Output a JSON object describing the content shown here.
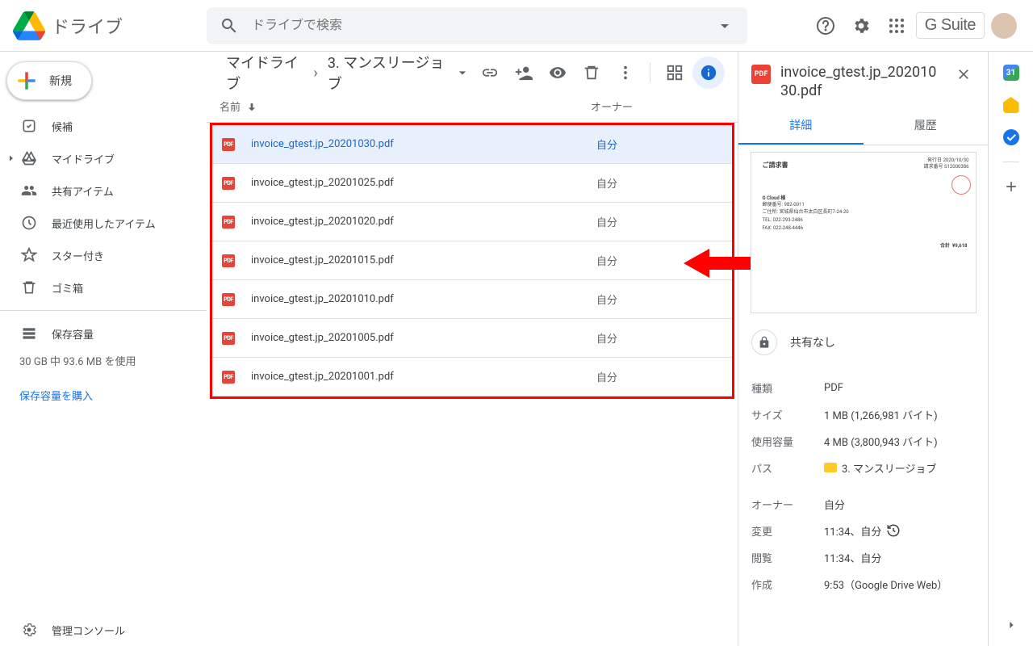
{
  "header": {
    "app_name": "ドライブ",
    "search_placeholder": "ドライブで検索",
    "gsuite_label": "G Suite"
  },
  "sidebar": {
    "new_label": "新規",
    "items": [
      {
        "label": "候補",
        "icon": "priority"
      },
      {
        "label": "マイドライブ",
        "icon": "mydrive",
        "expandable": true
      },
      {
        "label": "共有アイテム",
        "icon": "shared"
      },
      {
        "label": "最近使用したアイテム",
        "icon": "recent"
      },
      {
        "label": "スター付き",
        "icon": "starred"
      },
      {
        "label": "ゴミ箱",
        "icon": "trash"
      }
    ],
    "storage_label": "保存容量",
    "storage_usage": "30 GB 中 93.6 MB を使用",
    "buy_storage": "保存容量を購入",
    "admin_console": "管理コンソール"
  },
  "breadcrumb": {
    "root": "マイドライブ",
    "current": "3. マンスリージョブ"
  },
  "columns": {
    "name": "名前",
    "owner": "オーナー"
  },
  "files": [
    {
      "name": "invoice_gtest.jp_20201030.pdf",
      "owner": "自分",
      "selected": true
    },
    {
      "name": "invoice_gtest.jp_20201025.pdf",
      "owner": "自分"
    },
    {
      "name": "invoice_gtest.jp_20201020.pdf",
      "owner": "自分"
    },
    {
      "name": "invoice_gtest.jp_20201015.pdf",
      "owner": "自分"
    },
    {
      "name": "invoice_gtest.jp_20201010.pdf",
      "owner": "自分"
    },
    {
      "name": "invoice_gtest.jp_20201005.pdf",
      "owner": "自分"
    },
    {
      "name": "invoice_gtest.jp_20201001.pdf",
      "owner": "自分"
    }
  ],
  "details": {
    "filename": "invoice_gtest.jp_20201030.pdf",
    "tabs": {
      "detail": "詳細",
      "history": "履歴"
    },
    "share_status": "共有なし",
    "preview": {
      "title": "ご請求書",
      "issue_date_label": "発行日",
      "issue_date": "2020/10/30",
      "number_label": "請求番号",
      "number": "S12000386",
      "to": "G Cloud 様",
      "postal": "982-0011",
      "address": "宮城県仙台市太白区長町7-24-20",
      "tel": "022-293-2486",
      "fax": "022-248-4446",
      "amount_label": "合計",
      "amount": "¥9,618"
    },
    "rows": {
      "type_label": "種類",
      "type_value": "PDF",
      "size_label": "サイズ",
      "size_value": "1 MB (1,266,981 バイト)",
      "usage_label": "使用容量",
      "usage_value": "4 MB (3,800,943 バイト)",
      "path_label": "パス",
      "path_value": "3. マンスリージョブ",
      "owner_label": "オーナー",
      "owner_value": "自分",
      "modified_label": "変更",
      "modified_value": "11:34、自分",
      "viewed_label": "閲覧",
      "viewed_value": "11:34、自分",
      "created_label": "作成",
      "created_value": "9:53（Google Drive Web）"
    }
  },
  "pdf_badge": "PDF"
}
